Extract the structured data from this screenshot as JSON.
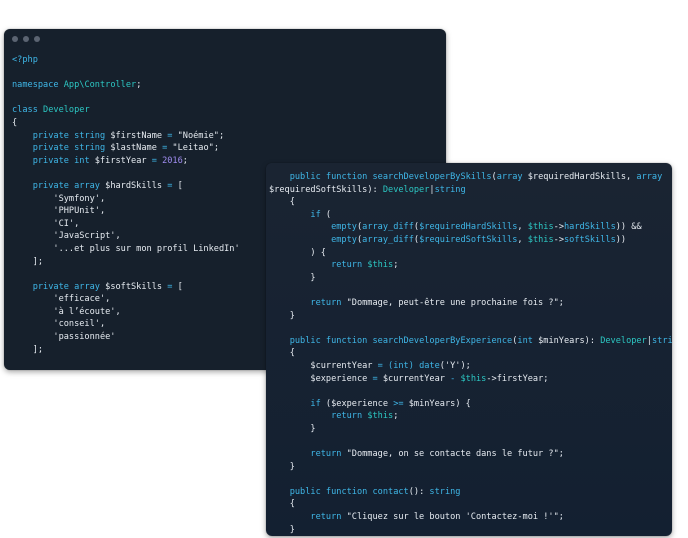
{
  "window_left": {
    "lines": [
      [
        {
          "t": "<?php",
          "c": "kw"
        }
      ],
      [],
      [
        {
          "t": "namespace ",
          "c": "kw"
        },
        {
          "t": "App\\Controller",
          "c": "cls"
        },
        {
          "t": ";",
          "c": "pl"
        }
      ],
      [],
      [
        {
          "t": "class ",
          "c": "kw"
        },
        {
          "t": "Developer",
          "c": "cls"
        }
      ],
      [
        {
          "t": "{",
          "c": "pl"
        }
      ],
      [
        {
          "t": "    private ",
          "c": "kw"
        },
        {
          "t": "string ",
          "c": "kw"
        },
        {
          "t": "$firstName",
          "c": "var"
        },
        {
          "t": " = ",
          "c": "kw"
        },
        {
          "t": "\"Noémie\"",
          "c": "str"
        },
        {
          "t": ";",
          "c": "pl"
        }
      ],
      [
        {
          "t": "    private ",
          "c": "kw"
        },
        {
          "t": "string ",
          "c": "kw"
        },
        {
          "t": "$lastName",
          "c": "var"
        },
        {
          "t": " = ",
          "c": "kw"
        },
        {
          "t": "\"Leitao\"",
          "c": "str"
        },
        {
          "t": ";",
          "c": "pl"
        }
      ],
      [
        {
          "t": "    private ",
          "c": "kw"
        },
        {
          "t": "int ",
          "c": "kw"
        },
        {
          "t": "$firstYear",
          "c": "var"
        },
        {
          "t": " = ",
          "c": "kw"
        },
        {
          "t": "2016",
          "c": "num"
        },
        {
          "t": ";",
          "c": "pl"
        }
      ],
      [],
      [
        {
          "t": "    private ",
          "c": "kw"
        },
        {
          "t": "array ",
          "c": "kw"
        },
        {
          "t": "$hardSkills",
          "c": "var"
        },
        {
          "t": " = ",
          "c": "kw"
        },
        {
          "t": "[",
          "c": "pl"
        }
      ],
      [
        {
          "t": "        'Symfony',",
          "c": "str"
        }
      ],
      [
        {
          "t": "        'PHPUnit',",
          "c": "str"
        }
      ],
      [
        {
          "t": "        'CI',",
          "c": "str"
        }
      ],
      [
        {
          "t": "        'JavaScript',",
          "c": "str"
        }
      ],
      [
        {
          "t": "        '...et plus sur mon profil LinkedIn'",
          "c": "str"
        }
      ],
      [
        {
          "t": "    ];",
          "c": "pl"
        }
      ],
      [],
      [
        {
          "t": "    private ",
          "c": "kw"
        },
        {
          "t": "array ",
          "c": "kw"
        },
        {
          "t": "$softSkills",
          "c": "var"
        },
        {
          "t": " = ",
          "c": "kw"
        },
        {
          "t": "[",
          "c": "pl"
        }
      ],
      [
        {
          "t": "        'efficace',",
          "c": "str"
        }
      ],
      [
        {
          "t": "        'à l’écoute',",
          "c": "str"
        }
      ],
      [
        {
          "t": "        'conseil',",
          "c": "str"
        }
      ],
      [
        {
          "t": "        'passionnée'",
          "c": "str"
        }
      ],
      [
        {
          "t": "    ];",
          "c": "pl"
        }
      ]
    ]
  },
  "window_right": {
    "lines": [
      [
        {
          "t": "    public ",
          "c": "kw"
        },
        {
          "t": "function ",
          "c": "kw"
        },
        {
          "t": "searchDeveloperBySkills",
          "c": "kw"
        },
        {
          "t": "(",
          "c": "pl"
        },
        {
          "t": "array ",
          "c": "kw"
        },
        {
          "t": "$requiredHardSkills",
          "c": "var"
        },
        {
          "t": ", ",
          "c": "pl"
        },
        {
          "t": "array",
          "c": "kw"
        }
      ],
      [
        {
          "t": "$requiredSoftSkills",
          "c": "var"
        },
        {
          "t": "): ",
          "c": "pl"
        },
        {
          "t": "Developer",
          "c": "cls"
        },
        {
          "t": "|",
          "c": "pl"
        },
        {
          "t": "string",
          "c": "kw"
        }
      ],
      [
        {
          "t": "    {",
          "c": "pl"
        }
      ],
      [
        {
          "t": "        if ",
          "c": "kw"
        },
        {
          "t": "(",
          "c": "pl"
        }
      ],
      [
        {
          "t": "            empty",
          "c": "kw"
        },
        {
          "t": "(",
          "c": "pl"
        },
        {
          "t": "array_diff",
          "c": "kw"
        },
        {
          "t": "(",
          "c": "pl"
        },
        {
          "t": "$requiredHardSkills",
          "c": "kw"
        },
        {
          "t": ", ",
          "c": "pl"
        },
        {
          "t": "$this",
          "c": "cls"
        },
        {
          "t": "->",
          "c": "pl"
        },
        {
          "t": "hardSkills",
          "c": "kw"
        },
        {
          "t": ")) &&",
          "c": "pl"
        }
      ],
      [
        {
          "t": "            empty",
          "c": "kw"
        },
        {
          "t": "(",
          "c": "pl"
        },
        {
          "t": "array_diff",
          "c": "kw"
        },
        {
          "t": "(",
          "c": "pl"
        },
        {
          "t": "$requiredSoftSkills",
          "c": "kw"
        },
        {
          "t": ", ",
          "c": "pl"
        },
        {
          "t": "$this",
          "c": "cls"
        },
        {
          "t": "->",
          "c": "pl"
        },
        {
          "t": "softSkills",
          "c": "kw"
        },
        {
          "t": "))",
          "c": "pl"
        }
      ],
      [
        {
          "t": "        ) {",
          "c": "pl"
        }
      ],
      [
        {
          "t": "            return ",
          "c": "kw"
        },
        {
          "t": "$this",
          "c": "cls"
        },
        {
          "t": ";",
          "c": "pl"
        }
      ],
      [
        {
          "t": "        }",
          "c": "pl"
        }
      ],
      [],
      [
        {
          "t": "        return ",
          "c": "kw"
        },
        {
          "t": "\"Dommage, peut-être une prochaine fois ?\"",
          "c": "str"
        },
        {
          "t": ";",
          "c": "pl"
        }
      ],
      [
        {
          "t": "    }",
          "c": "pl"
        }
      ],
      [],
      [
        {
          "t": "    public ",
          "c": "kw"
        },
        {
          "t": "function ",
          "c": "kw"
        },
        {
          "t": "searchDeveloperByExperience",
          "c": "kw"
        },
        {
          "t": "(",
          "c": "pl"
        },
        {
          "t": "int ",
          "c": "kw"
        },
        {
          "t": "$minYears",
          "c": "var"
        },
        {
          "t": "): ",
          "c": "pl"
        },
        {
          "t": "Developer",
          "c": "cls"
        },
        {
          "t": "|",
          "c": "pl"
        },
        {
          "t": "string",
          "c": "kw"
        }
      ],
      [
        {
          "t": "    {",
          "c": "pl"
        }
      ],
      [
        {
          "t": "        $currentYear",
          "c": "var"
        },
        {
          "t": " = ",
          "c": "kw"
        },
        {
          "t": "(int) ",
          "c": "kw"
        },
        {
          "t": "date",
          "c": "kw"
        },
        {
          "t": "('Y');",
          "c": "pl"
        }
      ],
      [
        {
          "t": "        $experience",
          "c": "var"
        },
        {
          "t": " = ",
          "c": "kw"
        },
        {
          "t": "$currentYear",
          "c": "var"
        },
        {
          "t": " - ",
          "c": "kw"
        },
        {
          "t": "$this",
          "c": "cls"
        },
        {
          "t": "->",
          "c": "pl"
        },
        {
          "t": "firstYear",
          "c": "var"
        },
        {
          "t": ";",
          "c": "pl"
        }
      ],
      [],
      [
        {
          "t": "        if ",
          "c": "kw"
        },
        {
          "t": "(",
          "c": "pl"
        },
        {
          "t": "$experience",
          "c": "var"
        },
        {
          "t": " >= ",
          "c": "kw"
        },
        {
          "t": "$minYears",
          "c": "var"
        },
        {
          "t": ") {",
          "c": "pl"
        }
      ],
      [
        {
          "t": "            return ",
          "c": "kw"
        },
        {
          "t": "$this",
          "c": "cls"
        },
        {
          "t": ";",
          "c": "pl"
        }
      ],
      [
        {
          "t": "        }",
          "c": "pl"
        }
      ],
      [],
      [
        {
          "t": "        return ",
          "c": "kw"
        },
        {
          "t": "\"Dommage, on se contacte dans le futur ?\"",
          "c": "str"
        },
        {
          "t": ";",
          "c": "pl"
        }
      ],
      [
        {
          "t": "    }",
          "c": "pl"
        }
      ],
      [],
      [
        {
          "t": "    public ",
          "c": "kw"
        },
        {
          "t": "function ",
          "c": "kw"
        },
        {
          "t": "contact",
          "c": "kw"
        },
        {
          "t": "(): ",
          "c": "pl"
        },
        {
          "t": "string",
          "c": "kw"
        }
      ],
      [
        {
          "t": "    {",
          "c": "pl"
        }
      ],
      [
        {
          "t": "        return ",
          "c": "kw"
        },
        {
          "t": "\"Cliquez sur le bouton 'Contactez-moi !'\"",
          "c": "str"
        },
        {
          "t": ";",
          "c": "pl"
        }
      ],
      [
        {
          "t": "    }",
          "c": "pl"
        }
      ],
      [
        {
          "t": "}",
          "c": "pl"
        }
      ]
    ]
  }
}
